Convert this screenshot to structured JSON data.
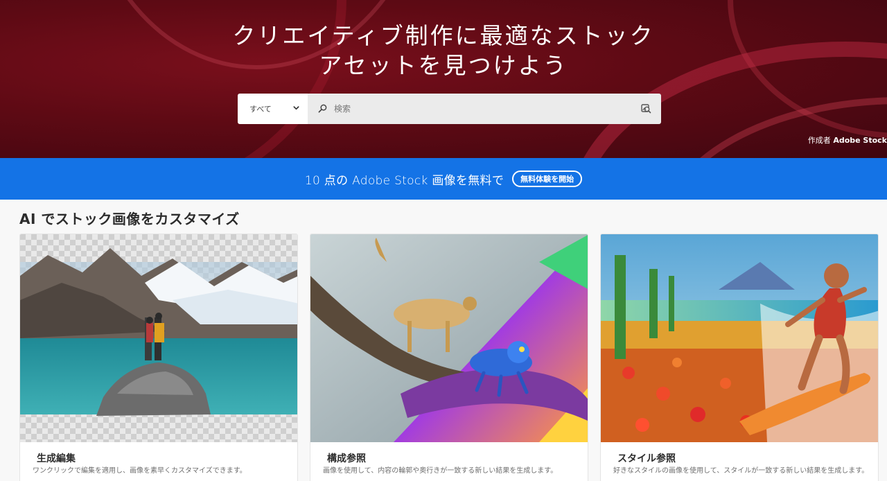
{
  "hero": {
    "title_line1": "クリエイティブ制作に最適なストック",
    "title_line2": "アセットを見つけよう",
    "credit_prefix": "作成者",
    "credit_name": "Adobe Stock"
  },
  "search": {
    "scope_value": "すべて",
    "placeholder": "検索"
  },
  "promo": {
    "text": "10 点の Adobe Stock 画像を無料で",
    "button_label": "無料体験を開始"
  },
  "section": {
    "title": "AI でストック画像をカスタマイズ"
  },
  "cards": [
    {
      "title": "生成編集",
      "description": "ワンクリックで編集を適用し、画像を素早くカスタマイズできます。"
    },
    {
      "title": "構成参照",
      "description": "画像を使用して、内容の輪郭や奥行きが一致する新しい結果を生成します。"
    },
    {
      "title": "スタイル参照",
      "description": "好きなスタイルの画像を使用して、スタイルが一致する新しい結果を生成します。"
    }
  ],
  "icons": {
    "scope_dropdown": "chevron-down-icon",
    "search": "search-icon",
    "visual_search": "visual-search-icon"
  },
  "colors": {
    "hero_bg": "#5e0a14",
    "promo_bg": "#1473e6",
    "search_field_bg": "#ebebeb"
  }
}
